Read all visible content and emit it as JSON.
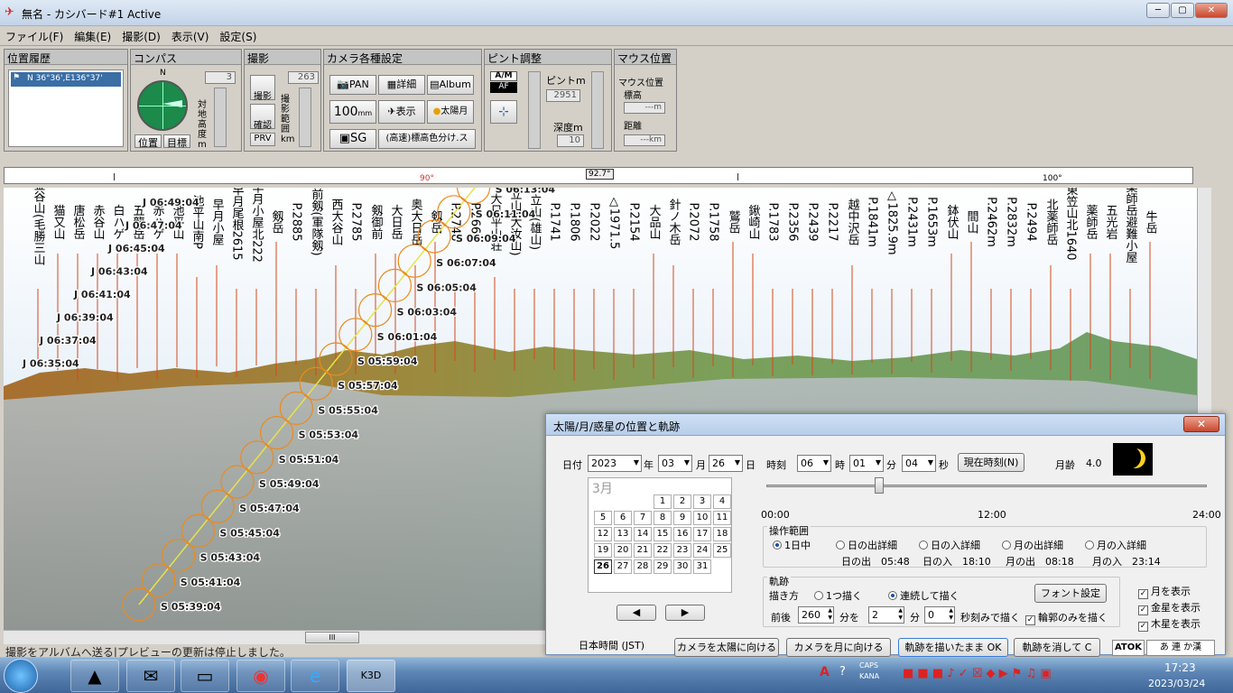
{
  "window": {
    "title": "無名 - カシバード#1 Active"
  },
  "menu": [
    "ファイル(F)",
    "編集(E)",
    "撮影(D)",
    "表示(V)",
    "設定(S)"
  ],
  "location_history": {
    "title": "位置履歴",
    "item": "N 36°36',E136°37'"
  },
  "compass": {
    "title": "コンパス",
    "north": "N",
    "altitude_value": "3",
    "vertical_label": "対地高度m",
    "pos_button": "位置",
    "target_button": "目標"
  },
  "shoot": {
    "title": "撮影",
    "shoot_button": "撮影",
    "confirm_button": "確認",
    "prv_button": "PRV",
    "range_value": "263",
    "vertical_label": "撮影範囲km"
  },
  "camera": {
    "title": "カメラ各種設定",
    "pan": "PAN",
    "detail": "詳細",
    "album": "Album",
    "lens": "100",
    "lens_unit": "mm",
    "display": "表示",
    "sun_moon": "太陽月",
    "sg": "SG",
    "color_mode": "(高速)標高色分け.ス"
  },
  "focus": {
    "title": "ピント調整",
    "am": "A/M",
    "af": "AF",
    "focus_label": "ピントm",
    "focus_value": "2951",
    "depth_label": "深度m",
    "depth_value": "10"
  },
  "mouse": {
    "title": "マウス位置",
    "pos_label": "マウス位置",
    "alt_label": "標高",
    "alt_value": "---m",
    "dist_label": "距離",
    "dist_value": "---km"
  },
  "ruler": {
    "labels": [
      "90°",
      "92.7°",
      "100°"
    ]
  },
  "peaks": [
    "釜谷山(毛勝三山)",
    "猫又山",
    "唐松岳",
    "赤谷山",
    "白ハゲ",
    "五龍岳",
    "赤ハゲ",
    "池平山",
    "池平山南P",
    "早月小屋",
    "早月尾根2615mP",
    "早月小屋北2224mP",
    "剱岳",
    "P.2885",
    "前剱(軍隊剱)",
    "西大谷山",
    "P.2785",
    "剱御前",
    "大日岳",
    "奥大日岳",
    "剱岳",
    "P.2748",
    "P.2665",
    "大日平山荘",
    "立山(大汝山)",
    "立山(雄山)",
    "P.1741",
    "P.1806",
    "P.2022",
    "△1971.5",
    "P.2154",
    "大品山",
    "針ノ木岳",
    "P.2072",
    "P.1758",
    "鷲岳",
    "鍬崎山",
    "P.1783",
    "P.2356",
    "P.2439",
    "P.2217",
    "越中沢岳",
    "P.1841m",
    "△1825.9m",
    "P.2431m",
    "P.1653m",
    "鉢伏山",
    "間山",
    "P.2462m",
    "P.2832m",
    "P.2494",
    "北薬師岳",
    "東笠山北1640m.P",
    "薬師岳",
    "五光岩",
    "薬師岳避難小屋",
    "牛岳"
  ],
  "moon_track": [
    "J 06:49:04",
    "J 06:47:04",
    "J 06:45:04",
    "J 06:43:04",
    "J 06:41:04",
    "J 06:39:04",
    "J 06:37:04",
    "J 06:35:04"
  ],
  "sun_track": [
    "S 06:13:04",
    "S 06:11:04",
    "S 06:09:04",
    "S 06:07:04",
    "S 06:05:04",
    "S 06:03:04",
    "S 06:01:04",
    "S 05:59:04",
    "S 05:57:04",
    "S 05:55:04",
    "S 05:53:04",
    "S 05:51:04",
    "S 05:49:04",
    "S 05:47:04",
    "S 05:45:04",
    "S 05:43:04",
    "S 05:41:04",
    "S 05:39:04"
  ],
  "status": {
    "text": "撮影をアルバムへ送る|プレビューの更新は停止しました。"
  },
  "dialog": {
    "title": "太陽/月/惑星の位置と軌跡",
    "date_label": "日付",
    "year": "2023",
    "year_unit": "年",
    "month": "03",
    "month_unit": "月",
    "day": "26",
    "day_unit": "日",
    "time_label": "時刻",
    "hour": "06",
    "hour_unit": "時",
    "minute": "01",
    "minute_unit": "分",
    "second": "04",
    "second_unit": "秒",
    "now_button": "現在時刻(N)",
    "moon_age_label": "月齢",
    "moon_age": "4.0",
    "calendar": {
      "month": "3月",
      "days": [
        "1",
        "2",
        "3",
        "4",
        "5",
        "6",
        "7",
        "8",
        "9",
        "10",
        "11",
        "12",
        "13",
        "14",
        "15",
        "16",
        "17",
        "18",
        "19",
        "20",
        "21",
        "22",
        "23",
        "24",
        "25",
        "26",
        "27",
        "28",
        "29",
        "30",
        "31"
      ]
    },
    "timeline": [
      "00:00",
      "12:00",
      "24:00"
    ],
    "range": {
      "title": "操作範囲",
      "options": [
        "1日中",
        "日の出詳細",
        "日の入詳細",
        "月の出詳細",
        "月の入詳細"
      ],
      "sunrise_label": "日の出",
      "sunrise": "05:48",
      "sunset_label": "日の入",
      "sunset": "18:10",
      "moonrise_label": "月の出",
      "moonrise": "08:18",
      "moonset_label": "月の入",
      "moonset": "23:14"
    },
    "track": {
      "title": "軌跡",
      "draw_label": "描き方",
      "opt_one": "1つ描く",
      "opt_cont": "連続して描く",
      "font_button": "フォント設定",
      "span_label": "前後",
      "span_value": "260",
      "span_unit": "分を",
      "step_value": "2",
      "step_unit": "分",
      "sec_value": "0",
      "sec_unit": "秒刻みで描く",
      "outline_check": "輪郭のみを描く"
    },
    "show": [
      "月を表示",
      "金星を表示",
      "木星を表示"
    ],
    "jst": "日本時間 (JST)",
    "btn_sun": "カメラを太陽に向ける",
    "btn_moon": "カメラを月に向ける",
    "btn_ok": "軌跡を描いたまま OK",
    "btn_clear": "軌跡を消して C"
  },
  "taskbar": {
    "time": "17:23",
    "date": "2023/03/24",
    "ime": "ATOK",
    "ime2": "あ 連 か漢",
    "caps": "CAPS",
    "kana": "KANA"
  }
}
